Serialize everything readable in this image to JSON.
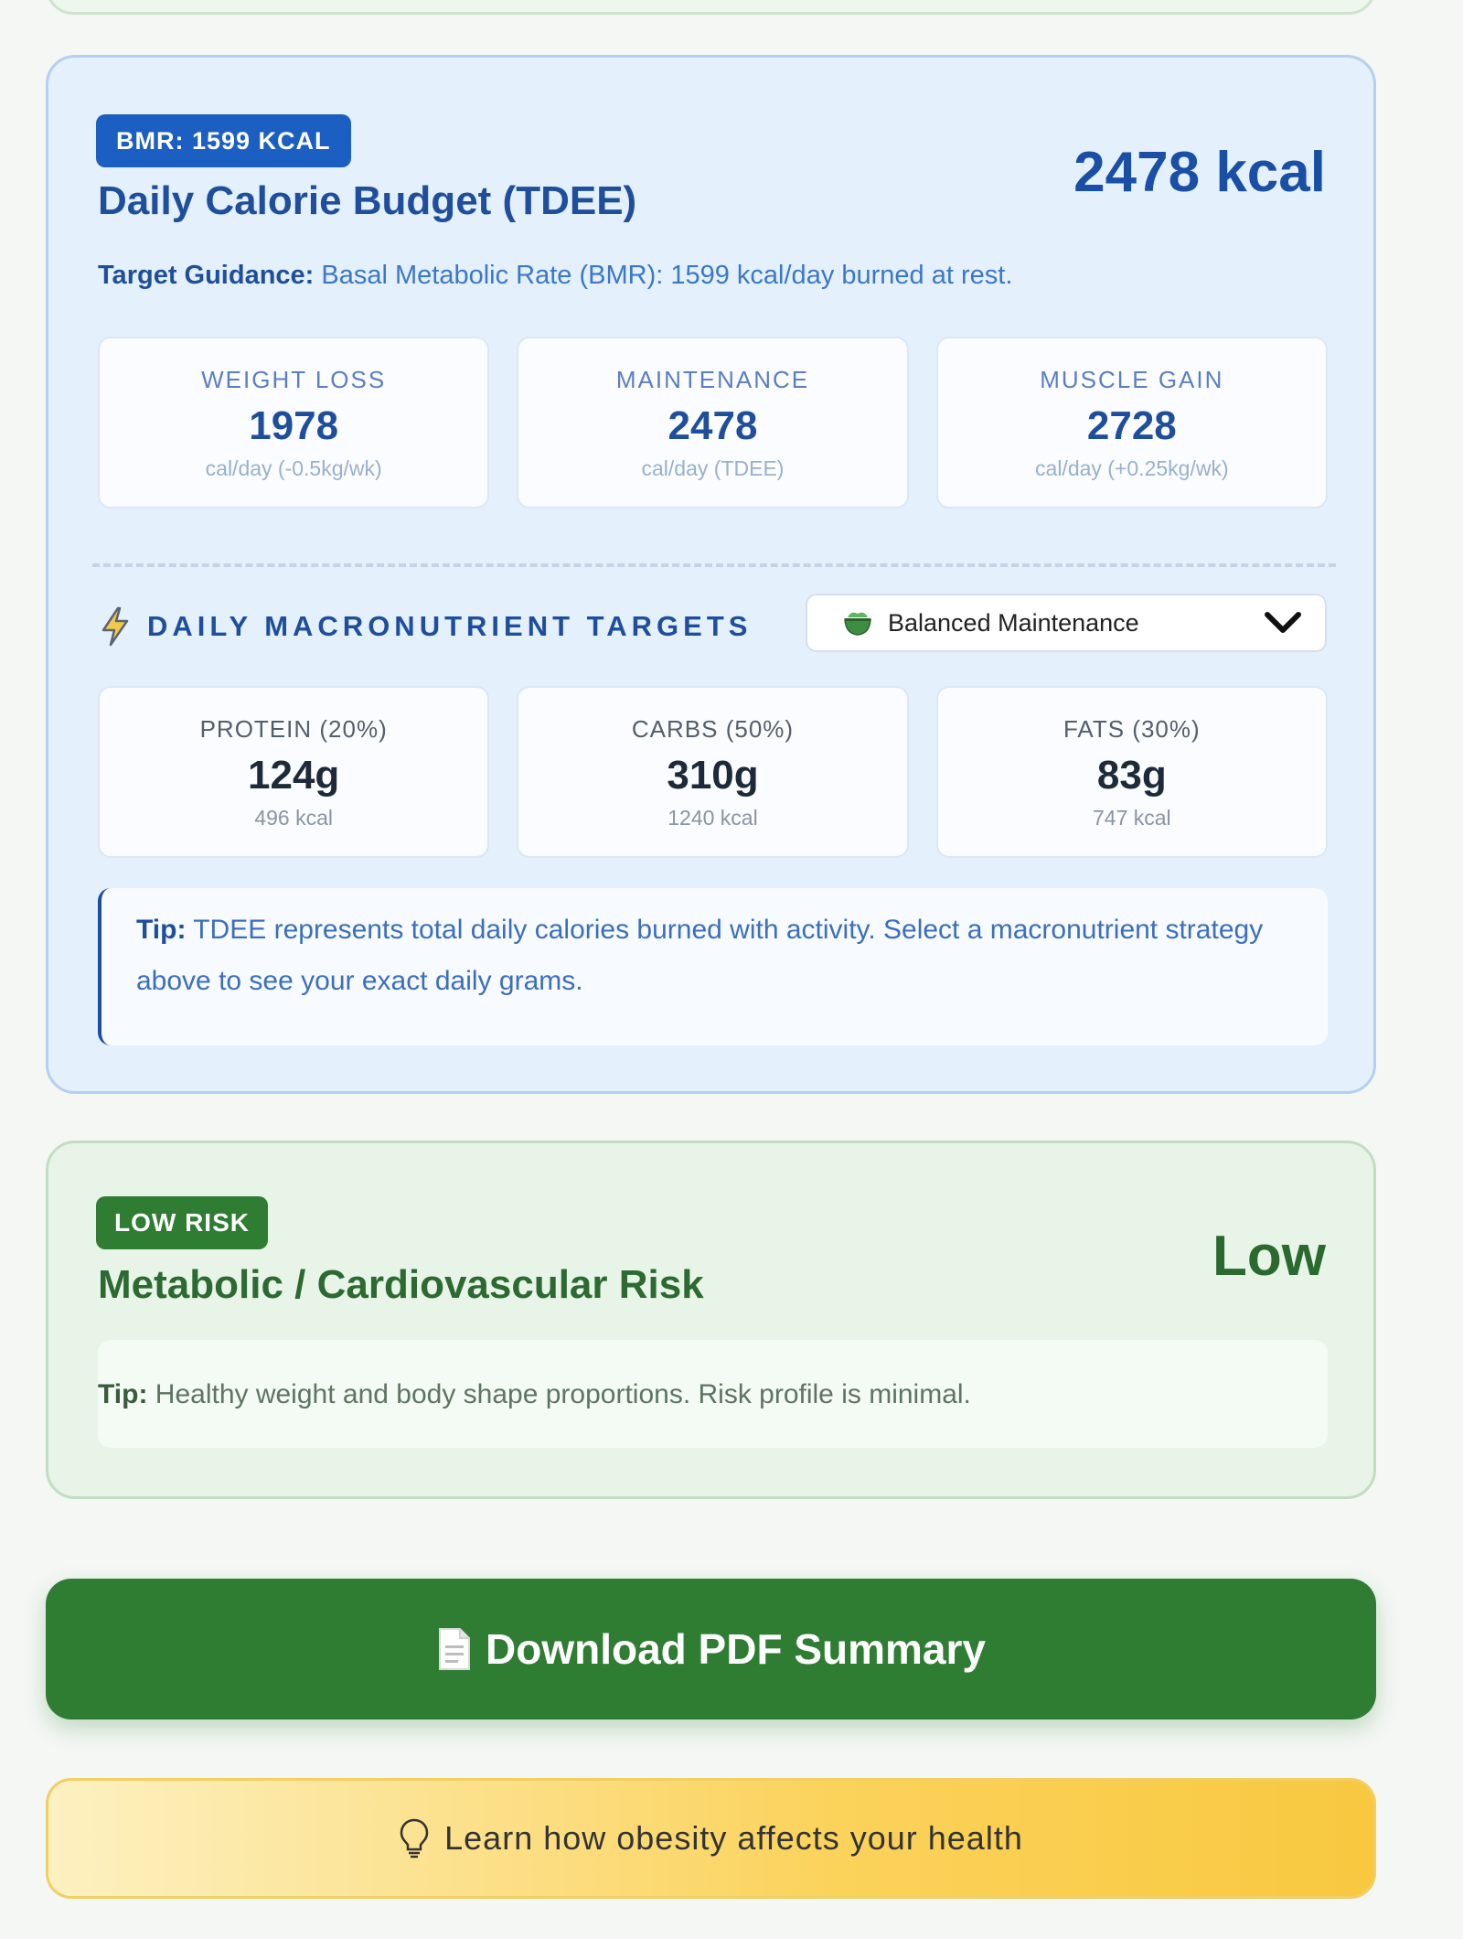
{
  "tdee": {
    "badge": "BMR: 1599 KCAL",
    "title": "Daily Calorie Budget (TDEE)",
    "value": "2478 kcal",
    "guidance_label": "Target Guidance:",
    "guidance_text": "Basal Metabolic Rate (BMR): 1599 kcal/day burned at rest.",
    "goals": [
      {
        "label": "WEIGHT LOSS",
        "value": "1978",
        "sub": "cal/day (-0.5kg/wk)"
      },
      {
        "label": "MAINTENANCE",
        "value": "2478",
        "sub": "cal/day (TDEE)"
      },
      {
        "label": "MUSCLE GAIN",
        "value": "2728",
        "sub": "cal/day (+0.25kg/wk)"
      }
    ],
    "macro_title": "DAILY MACRONUTRIENT TARGETS",
    "strategy_select": "Balanced Maintenance",
    "macros": [
      {
        "label": "PROTEIN (20%)",
        "value": "124g",
        "sub": "496 kcal"
      },
      {
        "label": "CARBS (50%)",
        "value": "310g",
        "sub": "1240 kcal"
      },
      {
        "label": "FATS (30%)",
        "value": "83g",
        "sub": "747 kcal"
      }
    ],
    "tip_label": "Tip:",
    "tip_text": "TDEE represents total daily calories burned with activity. Select a macronutrient strategy above to see your exact daily grams."
  },
  "risk": {
    "badge": "LOW RISK",
    "title": "Metabolic / Cardiovascular Risk",
    "value": "Low",
    "tip_label": "Tip:",
    "tip_text": "Healthy weight and body shape proportions. Risk profile is minimal."
  },
  "actions": {
    "download_label": "Download PDF Summary",
    "learn_label": "Learn how obesity affects your health"
  },
  "icons": {
    "macro": "lightning-bolt-icon",
    "select": "salad-bowl-icon",
    "download": "document-icon",
    "learn": "lightbulb-icon"
  },
  "colors": {
    "blue_accent": "#1f4f9c",
    "green_accent": "#2e7d32",
    "yellow_accent": "#fbd25a"
  }
}
